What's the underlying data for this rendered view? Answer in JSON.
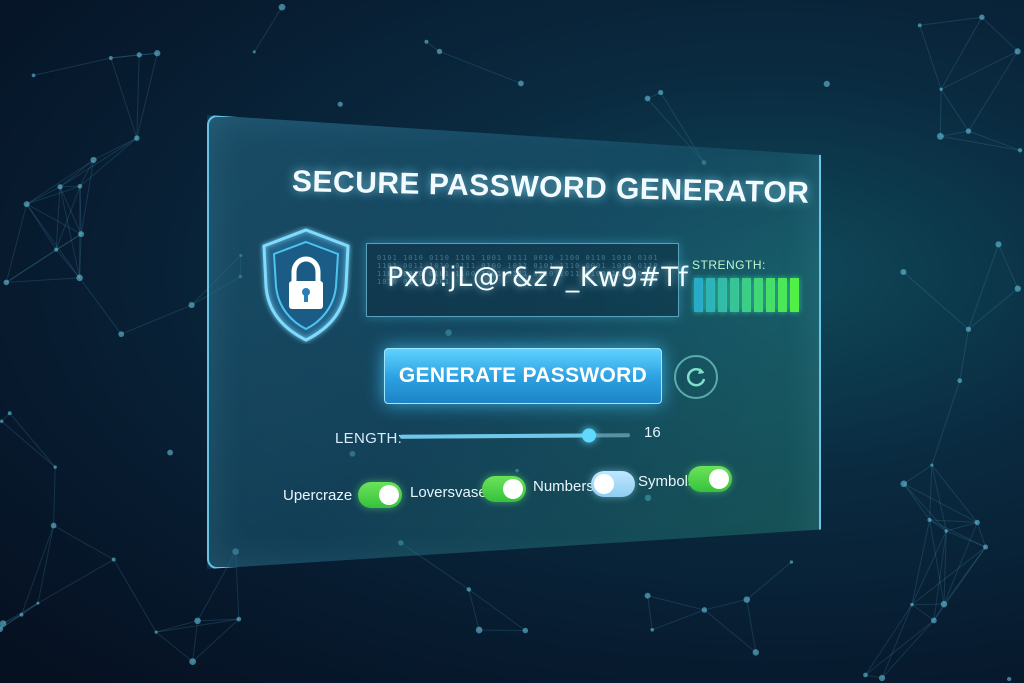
{
  "title": "SECURE PASSWORD GENERATOR",
  "password": {
    "value": "Px0!jL@r&z7_Kw9#Tf",
    "noise": "0101 1010 0110 1101 1001 0111 0010 1100 0110 1010 0101 1101 0011 1010 0111 0100 1011 0101 1110 0001 1010 0110 1101 0010 0101 1100 1001 0111 0110 1011 0100 1101 0011 1010 0111 0101"
  },
  "strength": {
    "label": "STRENGTH:",
    "level_fraction": 1.0,
    "segments": 9,
    "color": "#2ea89a"
  },
  "generate_button": {
    "label": "GENERATE PASSWORD"
  },
  "refresh_icon": "refresh-icon",
  "shield_icon": "shield-lock-icon",
  "length": {
    "label": "LENGTH:",
    "value": "16",
    "fraction": 0.82
  },
  "options": [
    {
      "label": "Upercraze",
      "on": true
    },
    {
      "label": "Loversvase",
      "on": true
    },
    {
      "label": "Numbers",
      "on": false
    },
    {
      "label": "Symbols",
      "on": true
    }
  ],
  "colors": {
    "accent": "#5fd2ff",
    "toggle_on": "#4fd64a",
    "toggle_off": "#a8dcf5"
  }
}
